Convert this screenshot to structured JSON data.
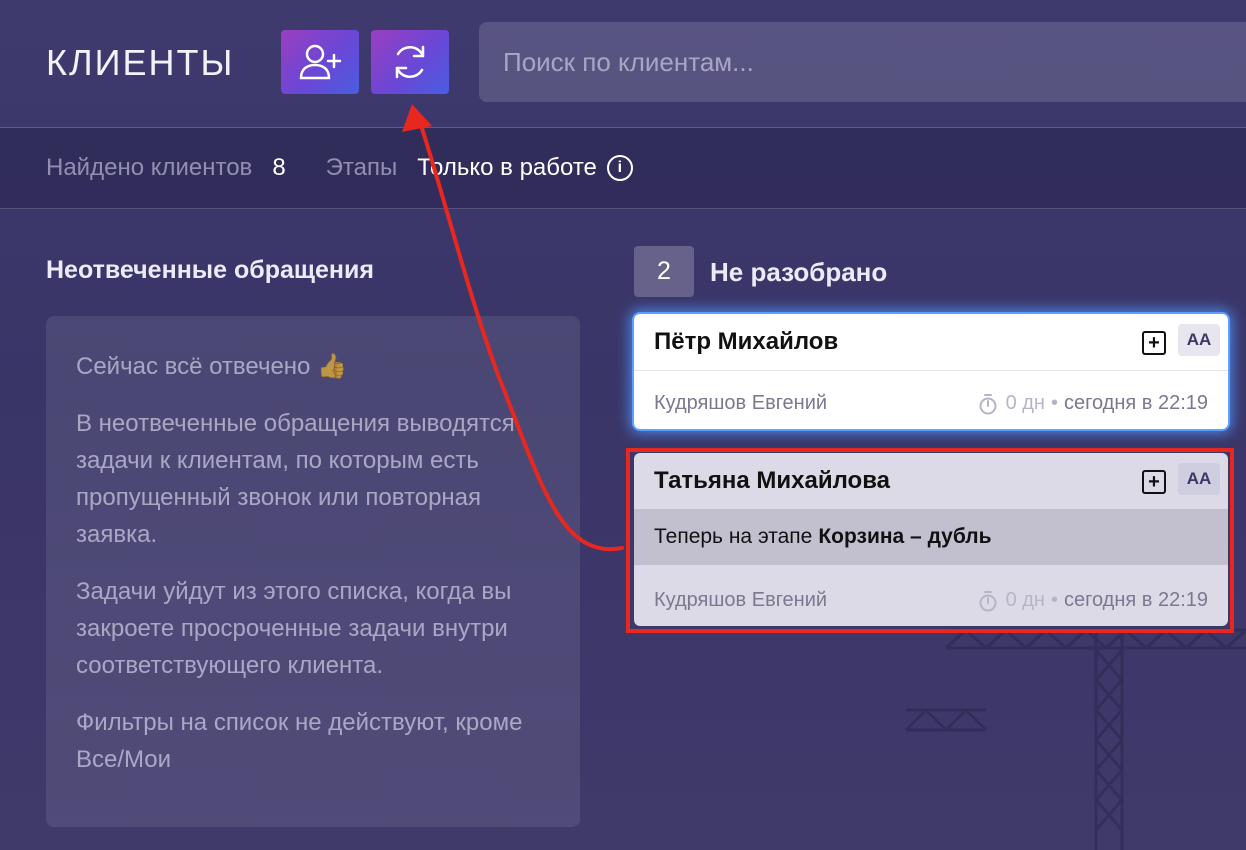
{
  "header": {
    "title": "КЛИЕНТЫ",
    "add_client_icon": "user-plus-icon",
    "refresh_icon": "refresh-icon",
    "search_placeholder": "Поиск по клиентам..."
  },
  "filters": {
    "found_label": "Найдено клиентов",
    "found_count": "8",
    "stages_label": "Этапы",
    "only_active_label": "Только в работе",
    "info_icon": "info-icon"
  },
  "unanswered": {
    "heading": "Неотвеченные обращения",
    "status": "Сейчас всё отвечено 👍",
    "paragraphs": [
      "В неотвеченные обращения выводятся задачи к клиентам, по которым есть пропущенный звонок или повторная заявка.",
      "Задачи уйдут из этого списка, когда вы закроете просроченные задачи внутри соответствующего клиента.",
      "Фильтры на список не действуют, кроме Все/Мои"
    ]
  },
  "column": {
    "count": "2",
    "title": "Не разобрано",
    "cards": [
      {
        "name": "Пётр Михайлов",
        "aa": "AA",
        "manager": "Кудряшов Евгений",
        "days": "0 дн",
        "separator": "•",
        "date": "сегодня в 22:19"
      },
      {
        "name": "Татьяна Михайлова",
        "aa": "AA",
        "stage_prefix": "Теперь на этапе",
        "stage_name": "Корзина – дубль",
        "manager": "Кудряшов Евгений",
        "days": "0 дн",
        "separator": "•",
        "date": "сегодня в 22:19"
      }
    ]
  },
  "colors": {
    "background": "#3a3568",
    "button_gradient_start": "#9a3fc0",
    "button_gradient_end": "#4a5de0",
    "annotation_red": "#e8281f",
    "card_glow": "#5aa0ff"
  }
}
